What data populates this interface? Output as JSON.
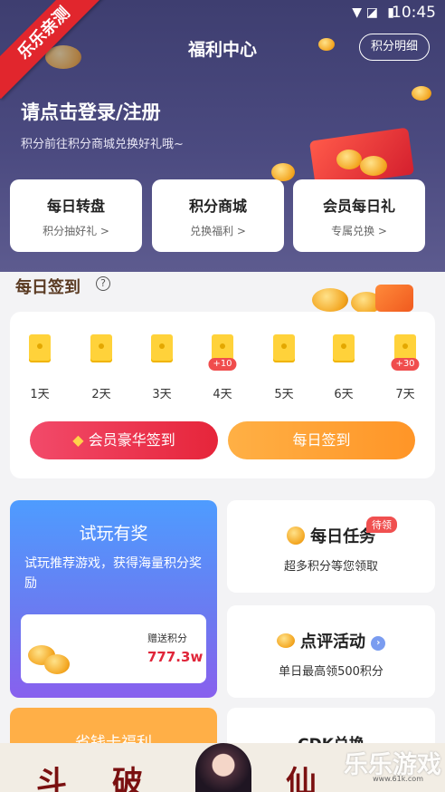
{
  "status_bar": {
    "time": "10:45"
  },
  "corner_ribbon": "乐乐亲测",
  "header": {
    "title": "福利中心",
    "points_detail": "积分明细"
  },
  "login": {
    "title": "请点击登录/注册",
    "subtitle": "积分前往积分商城兑换好礼哦~"
  },
  "quick_cards": [
    {
      "title": "每日转盘",
      "sub": "积分抽好礼 >"
    },
    {
      "title": "积分商城",
      "sub": "兑换福利 >"
    },
    {
      "title": "会员每日礼",
      "sub": "专属兑换 >"
    }
  ],
  "sign_in": {
    "title": "每日签到",
    "help": "?",
    "days": [
      {
        "label": "1天",
        "bonus": ""
      },
      {
        "label": "2天",
        "bonus": ""
      },
      {
        "label": "3天",
        "bonus": ""
      },
      {
        "label": "4天",
        "bonus": "+10"
      },
      {
        "label": "5天",
        "bonus": ""
      },
      {
        "label": "6天",
        "bonus": ""
      },
      {
        "label": "7天",
        "bonus": "+30"
      }
    ],
    "vip_button": "会员豪华签到",
    "sign_button": "每日签到"
  },
  "trial": {
    "title": "试玩有奖",
    "desc": "试玩推荐游戏，获得海量积分奖励",
    "gift_label": "赠送积分",
    "gift_value": "777.3w"
  },
  "daily_task": {
    "title": "每日任务",
    "tag": "待领",
    "sub": "超多积分等您领取"
  },
  "review": {
    "title": "点评活动",
    "sub": "单日最高领500积分"
  },
  "save_card": {
    "title": "省钱卡福利"
  },
  "cdk": {
    "title": "CDK兑换"
  },
  "banner": {
    "chars": [
      "斗",
      "破",
      "仙"
    ]
  },
  "watermark": {
    "main": "乐乐游戏",
    "sub": "www.61k.com"
  }
}
